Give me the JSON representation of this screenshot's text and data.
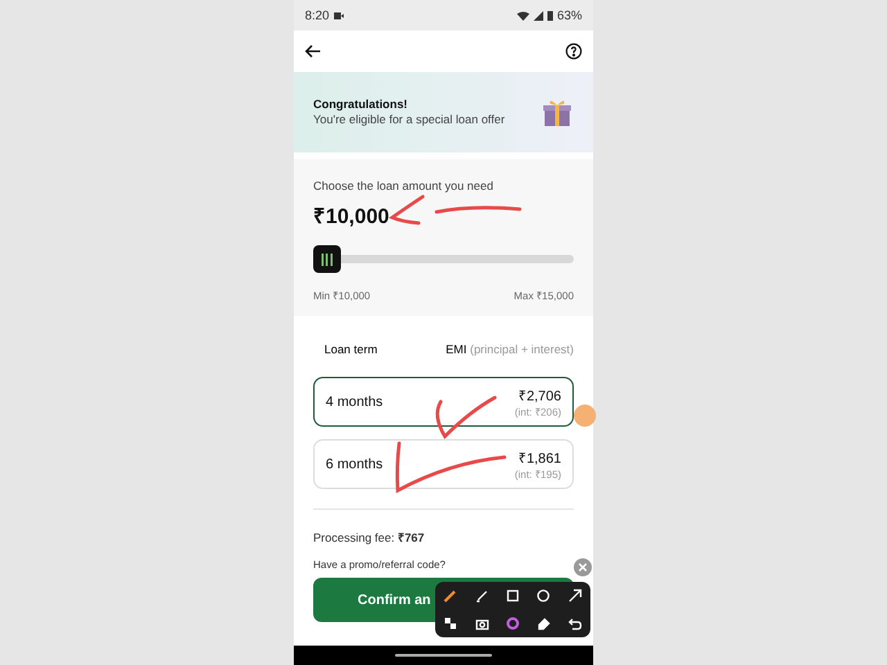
{
  "status_bar": {
    "time": "8:20",
    "battery": "63%"
  },
  "banner": {
    "title": "Congratulations!",
    "text": "You're eligible for a special loan offer"
  },
  "amount": {
    "label": "Choose the loan amount you need",
    "value": "₹10,000",
    "level": 0,
    "min": "Min ₹10,000",
    "max": "Max ₹15,000"
  },
  "terms": {
    "column_1": "Loan term",
    "column_2": "EMI",
    "column_2_note": "(principal + interest)",
    "options": [
      {
        "term": "4 months",
        "emi": "₹2,706",
        "interest": "(int: ₹206)",
        "selected": true
      },
      {
        "term": "6 months",
        "emi": "₹1,861",
        "interest": "(int: ₹195)",
        "selected": false
      }
    ]
  },
  "fee": "Processing fee: **₹767**",
  "promo": "Have a promo/referral code?",
  "confirm_button": "Confirm an"
}
